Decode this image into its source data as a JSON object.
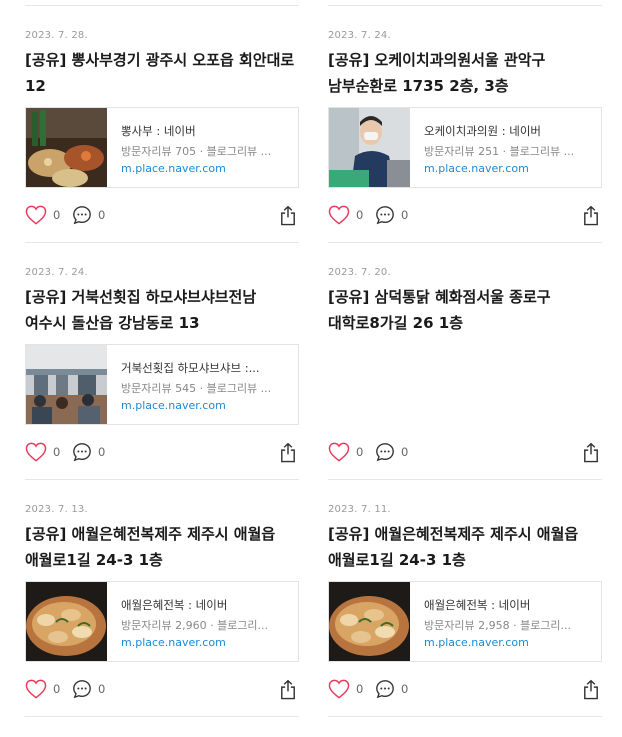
{
  "colors": {
    "like": "#e8395a",
    "link": "#1a8bd6"
  },
  "posts": [
    {
      "date": "2023. 7. 28.",
      "title": "[공유] 뽕사부경기 광주시 오포읍 회안대로 12",
      "link": {
        "title": "뽕사부 : 네이버",
        "desc": "방문자리뷰 705 · 블로그리뷰 ...",
        "url": "m.place.naver.com",
        "thumb": "food-beer"
      },
      "likes": "0",
      "comments": "0"
    },
    {
      "date": "2023. 7. 24.",
      "title": "[공유] 오케이치과의원서울 관악구 남부순환로 1735 2층, 3층",
      "link": {
        "title": "오케이치과의원 : 네이버",
        "desc": "방문자리뷰 251 · 블로그리뷰 ...",
        "url": "m.place.naver.com",
        "thumb": "dentist"
      },
      "likes": "0",
      "comments": "0"
    },
    {
      "date": "2023. 7. 24.",
      "title": "[공유] 거북선횟집 하모샤브샤브전남 여수시 돌산읍 강남동로 13",
      "link": {
        "title": "거북선횟집 하모샤브샤브 :...",
        "desc": "방문자리뷰 545 · 블로그리뷰 ...",
        "url": "m.place.naver.com",
        "thumb": "restaurant-hall"
      },
      "likes": "0",
      "comments": "0"
    },
    {
      "date": "2023. 7. 20.",
      "title": "[공유] 삼덕통닭 혜화점서울 종로구 대학로8가길 26 1층",
      "link": null,
      "likes": "0",
      "comments": "0"
    },
    {
      "date": "2023. 7. 13.",
      "title": "[공유] 애월은혜전복제주 제주시 애월읍 애월로1길 24-3 1층",
      "link": {
        "title": "애월은혜전복 : 네이버",
        "desc": "방문자리뷰 2,960 · 블로그리...",
        "url": "m.place.naver.com",
        "thumb": "abalone"
      },
      "likes": "0",
      "comments": "0"
    },
    {
      "date": "2023. 7. 11.",
      "title": "[공유] 애월은혜전복제주 제주시 애월읍 애월로1길 24-3 1층",
      "link": {
        "title": "애월은혜전복 : 네이버",
        "desc": "방문자리뷰 2,958 · 블로그리...",
        "url": "m.place.naver.com",
        "thumb": "abalone"
      },
      "likes": "0",
      "comments": "0"
    }
  ]
}
